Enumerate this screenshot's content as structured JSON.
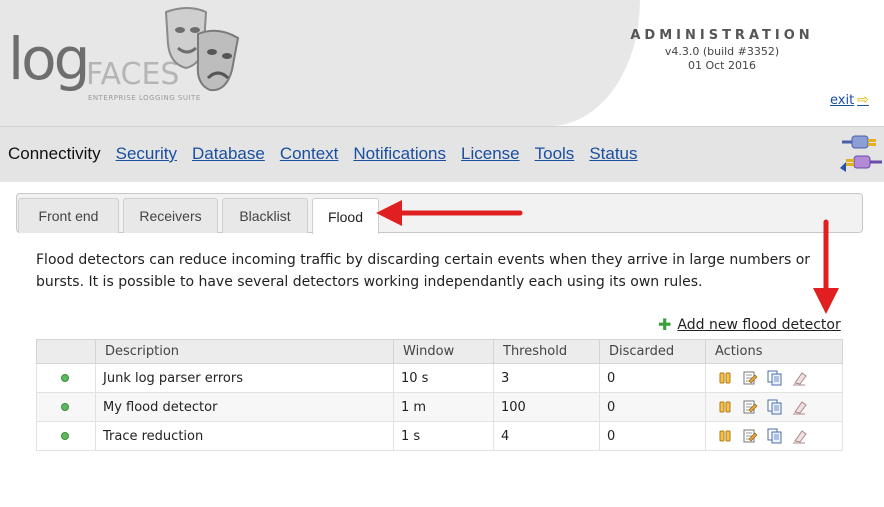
{
  "header": {
    "logo": {
      "main": "log",
      "secondary": "FACES",
      "tagline": "ENTERPRISE LOGGING SUITE"
    },
    "admin": {
      "title": "ADMINISTRATION",
      "version": "v4.3.0 (build #3352)",
      "date": "01 Oct 2016"
    },
    "exit_label": "exit"
  },
  "nav": {
    "active": "Connectivity",
    "links": [
      "Security",
      "Database",
      "Context",
      "Notifications",
      "License",
      "Tools",
      "Status"
    ]
  },
  "tabs": [
    {
      "label": "Front end"
    },
    {
      "label": "Receivers"
    },
    {
      "label": "Blacklist"
    },
    {
      "label": "Flood",
      "active": true
    }
  ],
  "description": "Flood detectors can reduce incoming traffic by discarding certain events when they arrive in large numbers or bursts. It is possible to have several detectors working independantly each using its own rules.",
  "add_label": "Add new flood detector",
  "table": {
    "headers": [
      "",
      "Description",
      "Window",
      "Threshold",
      "Discarded",
      "Actions"
    ],
    "rows": [
      {
        "status": "active",
        "description": "Junk log parser errors",
        "window": "10 s",
        "threshold": "3",
        "discarded": "0"
      },
      {
        "status": "active",
        "description": "My flood detector",
        "window": "1 m",
        "threshold": "100",
        "discarded": "0"
      },
      {
        "status": "active",
        "description": "Trace reduction",
        "window": "1 s",
        "threshold": "4",
        "discarded": "0"
      }
    ],
    "action_icons": [
      "pause-icon",
      "edit-icon",
      "copy-icon",
      "delete-icon"
    ]
  },
  "colors": {
    "link": "#1a4fa0",
    "status_active": "#5cb85c",
    "annotation_arrow": "#e02020"
  }
}
